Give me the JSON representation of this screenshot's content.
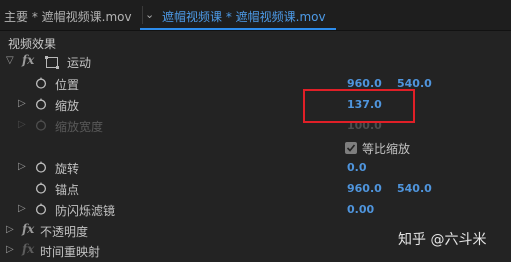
{
  "tabs": {
    "source_label": "主要 * 遮帽视频课.mov",
    "sequence_label": "遮帽视频课 * 遮帽视频课.mov"
  },
  "panel": {
    "title": "视频效果"
  },
  "motion": {
    "fx_label": "fx",
    "name": "运动",
    "position": {
      "label": "位置",
      "x": "960.0",
      "y": "540.0"
    },
    "scale": {
      "label": "缩放",
      "value": "137.0"
    },
    "scale_width": {
      "label": "缩放宽度",
      "value": "100.0"
    },
    "uniform_scale": {
      "label": "等比缩放",
      "checked": true
    },
    "rotation": {
      "label": "旋转",
      "value": "0.0"
    },
    "anchor": {
      "label": "锚点",
      "x": "960.0",
      "y": "540.0"
    },
    "anti_flicker": {
      "label": "防闪烁滤镜",
      "value": "0.00"
    }
  },
  "opacity": {
    "fx_label": "fx",
    "name": "不透明度"
  },
  "time_remap": {
    "fx_label": "fx",
    "name": "时间重映射"
  },
  "watermark": "知乎 @六斗米",
  "colors": {
    "value_blue": "#4f95dd",
    "highlight_red": "#e01f27",
    "tab_active": "#4d9be8"
  }
}
